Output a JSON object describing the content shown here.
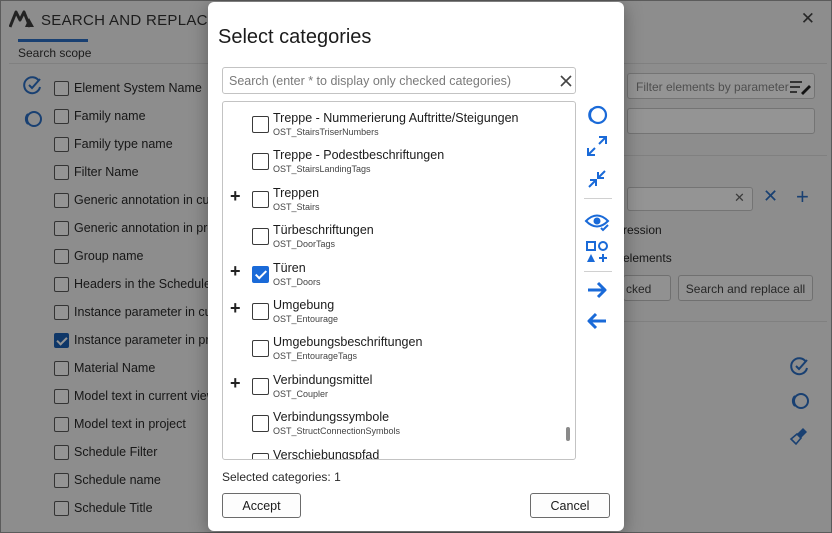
{
  "background_window": {
    "title": "SEARCH AND REPLACE",
    "close_glyph": "✕",
    "tab_label": "Search scope",
    "scope_items": [
      {
        "label": "Element System Name",
        "checked": false
      },
      {
        "label": "Family name",
        "checked": false
      },
      {
        "label": "Family type name",
        "checked": false
      },
      {
        "label": "Filter Name",
        "checked": false
      },
      {
        "label": "Generic annotation in cur",
        "checked": false
      },
      {
        "label": "Generic annotation in pro",
        "checked": false
      },
      {
        "label": "Group name",
        "checked": false
      },
      {
        "label": "Headers in the Schedule",
        "checked": false
      },
      {
        "label": "Instance parameter in cur",
        "checked": false
      },
      {
        "label": "Instance parameter in pro",
        "checked": true
      },
      {
        "label": "Material Name",
        "checked": false
      },
      {
        "label": "Model text in current view",
        "checked": false
      },
      {
        "label": "Model text in project",
        "checked": false
      },
      {
        "label": "Schedule Filter",
        "checked": false
      },
      {
        "label": "Schedule name",
        "checked": false
      },
      {
        "label": "Schedule Title",
        "checked": false
      }
    ],
    "filter_placeholder": "Filter elements by parameter",
    "expression_label": "ression",
    "elements_label": "elements",
    "partial_button_label": "cked",
    "search_replace_all_label": "Search and replace all"
  },
  "dialog": {
    "title": "Select categories",
    "search_placeholder": "Search (enter * to display only checked categories)",
    "categories": [
      {
        "name": "Treppe - Nummerierung Auftritte/Steigungen",
        "code": "OST_StairsTriserNumbers",
        "checked": false,
        "expandable": false
      },
      {
        "name": "Treppe - Podestbeschriftungen",
        "code": "OST_StairsLandingTags",
        "checked": false,
        "expandable": false
      },
      {
        "name": "Treppen",
        "code": "OST_Stairs",
        "checked": false,
        "expandable": true
      },
      {
        "name": "Türbeschriftungen",
        "code": "OST_DoorTags",
        "checked": false,
        "expandable": false
      },
      {
        "name": "Türen",
        "code": "OST_Doors",
        "checked": true,
        "expandable": true
      },
      {
        "name": "Umgebung",
        "code": "OST_Entourage",
        "checked": false,
        "expandable": true
      },
      {
        "name": "Umgebungsbeschriftungen",
        "code": "OST_EntourageTags",
        "checked": false,
        "expandable": false
      },
      {
        "name": "Verbindungsmittel",
        "code": "OST_Coupler",
        "checked": false,
        "expandable": true
      },
      {
        "name": "Verbindungssymbole",
        "code": "OST_StructConnectionSymbols",
        "checked": false,
        "expandable": false
      },
      {
        "name": "Verschiebungspfad",
        "code": "",
        "checked": false,
        "expandable": false
      }
    ],
    "expander_glyph": "+",
    "selected_count_text": "Selected categories: 1",
    "accept_label": "Accept",
    "cancel_label": "Cancel"
  },
  "colors": {
    "accent": "#1a6ad8",
    "icon_blue": "#2b6fc4",
    "overlay": "rgba(0,0,0,0.42)"
  },
  "icons": [
    "search-clear-icon",
    "refresh-icon",
    "expand-all-icon",
    "collapse-all-icon",
    "visibility-check-icon",
    "shapes-add-icon",
    "arrow-right-icon",
    "arrow-left-icon"
  ]
}
